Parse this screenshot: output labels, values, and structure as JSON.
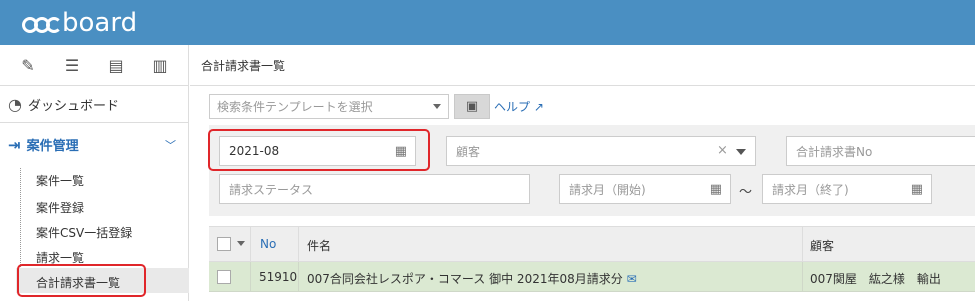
{
  "app": {
    "logo_text": "board"
  },
  "sidebar": {
    "tools": [
      {
        "icon": "pencil-icon",
        "glyph": "✎"
      },
      {
        "icon": "list-icon",
        "glyph": "☰"
      },
      {
        "icon": "table-list-icon",
        "glyph": "▤"
      },
      {
        "icon": "bar-chart-icon",
        "glyph": "▥"
      }
    ],
    "dashboard": "ダッシュボード",
    "case_mgmt": "案件管理",
    "sub_items": [
      "案件一覧",
      "案件登録",
      "案件CSV一括登録",
      "請求一覧",
      "合計請求書一覧"
    ]
  },
  "main": {
    "page_title": "合計請求書一覧",
    "template_placeholder": "検索条件テンプレートを選択",
    "help_label": "ヘルプ",
    "filters": {
      "month_value": "2021-08",
      "customer_placeholder": "顧客",
      "invoice_no_placeholder": "合計請求書No",
      "status_placeholder": "請求ステータス",
      "month_start_placeholder": "請求月（開始)",
      "tilde": "〜",
      "month_end_placeholder": "請求月（終了)"
    },
    "table": {
      "headers": {
        "no": "No",
        "subject": "件名",
        "customer": "顧客"
      },
      "rows": [
        {
          "no": "51910",
          "subject": "007合同会社レスポア・コマース 御中 2021年08月請求分",
          "customer": "007関屋　紘之様　輸出"
        }
      ]
    }
  },
  "colors": {
    "topbar": "#4a8fc2",
    "link": "#2a6eb5",
    "highlight": "#e0262a",
    "selected_row": "#dbe9d2"
  }
}
